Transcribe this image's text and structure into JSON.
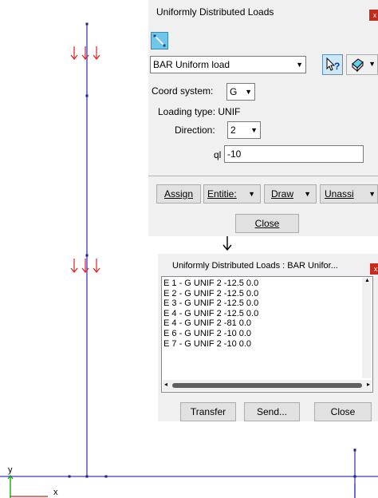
{
  "canvas": {
    "axis_y_label": "y",
    "axis_x_label": "x",
    "colors": {
      "member": "#3a3ac8",
      "load": "#e02020",
      "axis_y": "#00a000",
      "node": "#20207a"
    }
  },
  "dialog_loads": {
    "title": "Uniformly Distributed Loads",
    "close_glyph": "x",
    "load_type": "BAR Uniform load",
    "help_glyph": "?",
    "coord_label": "Coord system:",
    "coord_value": "G",
    "loading_type": "Loading type: UNIF",
    "direction_label": "Direction:",
    "direction_value": "2",
    "ql_label": "ql",
    "ql_value": "-10",
    "assign": "Assign",
    "entities": "Entitie:",
    "draw": "Draw",
    "unassign": "Unassi",
    "close": "Close"
  },
  "dialog_list": {
    "title": "Uniformly Distributed Loads : BAR Unifor...",
    "close_glyph": "x",
    "items": [
      "E 1 - G UNIF 2 -12.5 0.0",
      "E 2 - G UNIF 2 -12.5 0.0",
      "E 3 - G UNIF 2 -12.5 0.0",
      "E 4 - G UNIF 2 -12.5 0.0",
      "E 4 - G UNIF 2 -81 0.0",
      "E 6 - G UNIF 2 -10 0.0",
      "E 7 - G UNIF 2 -10 0.0"
    ],
    "transfer": "Transfer",
    "send": "Send...",
    "close": "Close"
  }
}
